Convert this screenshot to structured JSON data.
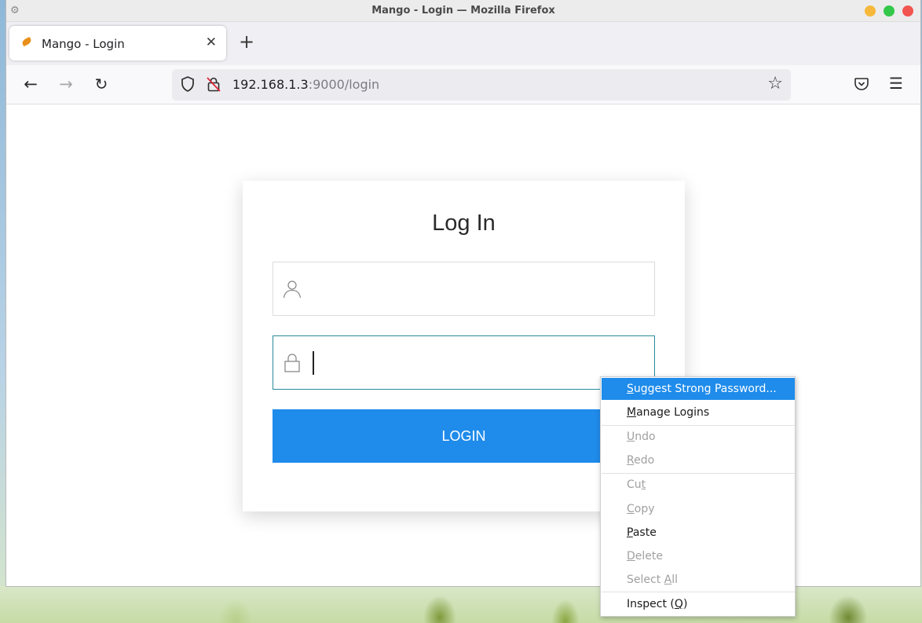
{
  "window": {
    "title": "Mango - Login — Mozilla Firefox"
  },
  "tabs": [
    {
      "label": "Mango - Login"
    }
  ],
  "urlbar": {
    "host": "192.168.1.3",
    "path": ":9000/login"
  },
  "login": {
    "heading": "Log In",
    "username_value": "",
    "password_value": "",
    "button_label": "LOGIN"
  },
  "context_menu": {
    "items": [
      {
        "pre": "",
        "key": "S",
        "post": "uggest Strong Password...",
        "state": "active"
      },
      {
        "pre": "",
        "key": "M",
        "post": "anage Logins",
        "state": "enabled"
      },
      {
        "pre": "",
        "key": "U",
        "post": "ndo",
        "state": "disabled"
      },
      {
        "pre": "",
        "key": "R",
        "post": "edo",
        "state": "disabled"
      },
      {
        "pre": "Cu",
        "key": "t",
        "post": "",
        "state": "disabled"
      },
      {
        "pre": "",
        "key": "C",
        "post": "opy",
        "state": "disabled"
      },
      {
        "pre": "",
        "key": "P",
        "post": "aste",
        "state": "enabled"
      },
      {
        "pre": "",
        "key": "D",
        "post": "elete",
        "state": "disabled"
      },
      {
        "pre": "Select ",
        "key": "A",
        "post": "ll",
        "state": "disabled"
      },
      {
        "pre": "Inspect (",
        "key": "Q",
        "post": ")",
        "state": "enabled"
      }
    ]
  },
  "colors": {
    "accent": "#1f8beb",
    "menu_highlight": "#1f8ceb",
    "focus_border": "#2a8a9a"
  },
  "icons": {
    "back": "arrow-left-icon",
    "forward": "arrow-right-icon",
    "reload": "reload-icon",
    "tracking": "shield-icon",
    "insecure": "insecure-lock-icon",
    "bookmark": "star-icon",
    "pocket": "pocket-icon",
    "menu": "hamburger-menu-icon",
    "user": "user-icon",
    "password": "lock-icon"
  }
}
